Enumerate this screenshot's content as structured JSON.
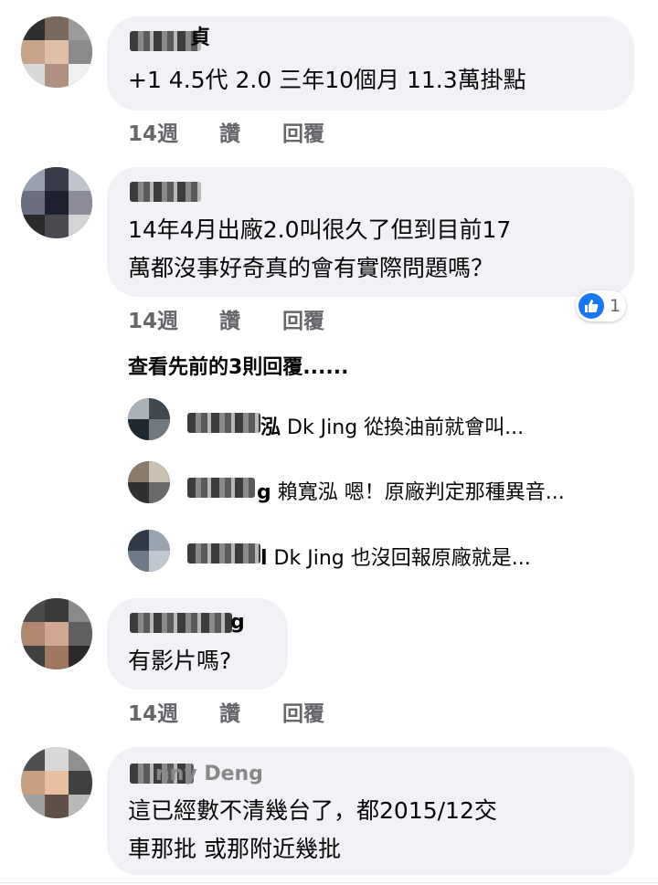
{
  "comments": [
    {
      "name_fragment": "貞",
      "text": "+1  4.5代 2.0 三年10個月 11.3萬掛點",
      "time": "14週",
      "like_label": "讚",
      "reply_label": "回覆"
    },
    {
      "name_fragment": "",
      "text_lines": [
        "14年4月出廠2.0叫很久了但到目前17",
        "萬都沒事好奇真的會有實際問題嗎？"
      ],
      "time": "14週",
      "like_label": "讚",
      "reply_label": "回覆",
      "reaction_count": "1",
      "view_previous": "查看先前的3則回覆......",
      "replies": [
        {
          "name_fragment": "泓",
          "text": " Dk Jing 從換油前就會叫..."
        },
        {
          "name_fragment": "g",
          "text": " 賴寬泓 嗯！原廠判定那種異音..."
        },
        {
          "name_fragment": "l",
          "text": " Dk Jing 也沒回報原廠就是..."
        }
      ]
    },
    {
      "name_fragment": "g",
      "text": "有影片嗎?",
      "time": "14週",
      "like_label": "讚",
      "reply_label": "回覆"
    },
    {
      "name_fragment": "nny Deng",
      "text_lines": [
        "這已經數不清幾台了，都2015/12交",
        "車那批 或那附近幾批"
      ]
    }
  ],
  "colors": {
    "bubble": "#f0f2f5",
    "meta": "#65676b",
    "like_blue": "#1877f2"
  },
  "icons": {
    "reaction": "like-icon"
  }
}
